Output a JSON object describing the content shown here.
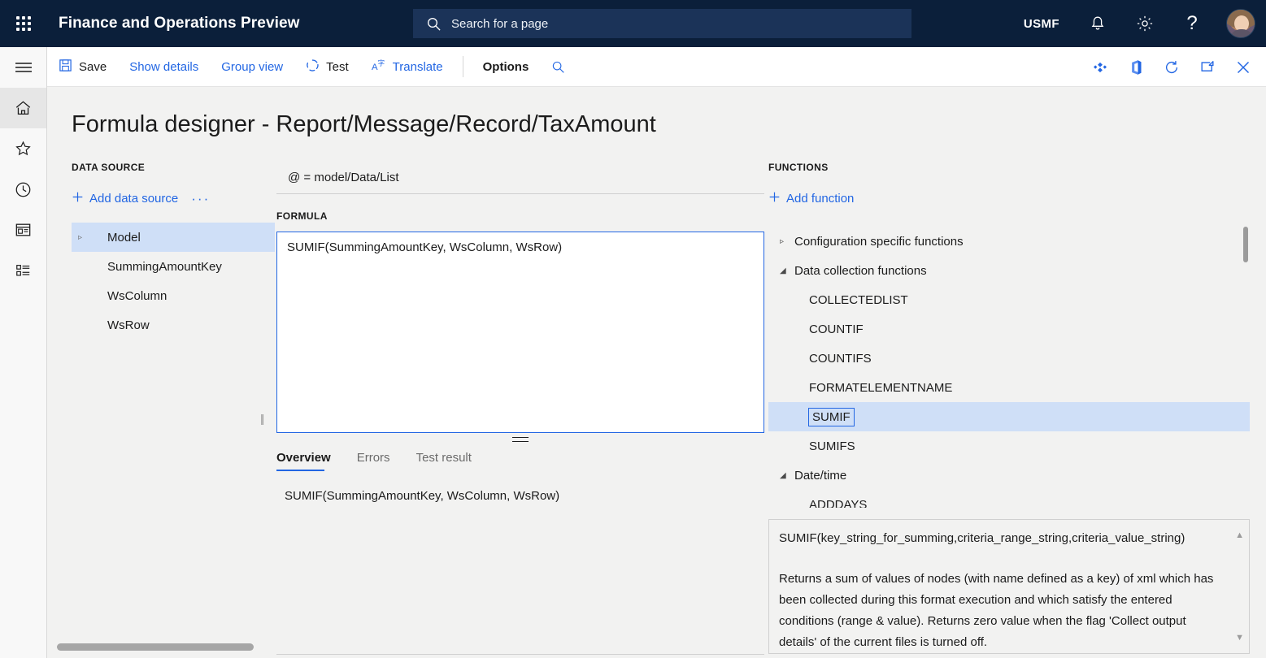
{
  "topbar": {
    "waffle_icon": "app-launcher-icon",
    "app_title": "Finance and Operations Preview",
    "search": {
      "icon": "search-icon",
      "placeholder": "Search for a page",
      "value": ""
    },
    "company": "USMF",
    "notifications_icon": "bell-icon",
    "settings_icon": "gear-icon",
    "help_icon": "question-mark-icon",
    "avatar_label": "user-avatar"
  },
  "rail": {
    "items": [
      {
        "name": "hamburger-menu",
        "icon": "hamburger-icon",
        "active": false
      },
      {
        "name": "home",
        "icon": "home-icon",
        "active": true
      },
      {
        "name": "favorites",
        "icon": "star-icon",
        "active": false
      },
      {
        "name": "recent",
        "icon": "clock-icon",
        "active": false
      },
      {
        "name": "workspaces",
        "icon": "workspace-icon",
        "active": false
      },
      {
        "name": "modules",
        "icon": "list-icon",
        "active": false
      }
    ]
  },
  "commandbar": {
    "save": {
      "label": "Save",
      "icon": "save-icon"
    },
    "show_details": {
      "label": "Show details"
    },
    "group_view": {
      "label": "Group view"
    },
    "test": {
      "label": "Test",
      "icon": "test-spinner-icon"
    },
    "translate": {
      "label": "Translate",
      "icon": "translate-icon"
    },
    "options": {
      "label": "Options"
    },
    "search": {
      "icon": "search-icon"
    },
    "right_icons": [
      {
        "name": "personalize-icon"
      },
      {
        "name": "office-app-icon"
      },
      {
        "name": "refresh-icon"
      },
      {
        "name": "open-in-new-window-icon"
      },
      {
        "name": "close-icon"
      }
    ]
  },
  "page": {
    "title": "Formula designer - Report/Message/Record/TaxAmount",
    "data_source": {
      "label": "DATA SOURCE",
      "add_button": "Add data source",
      "overflow_button": "···",
      "tree": [
        {
          "label": "Model",
          "expander": "▹",
          "selected": true,
          "leaf": false
        },
        {
          "label": "SummingAmountKey",
          "expander": "",
          "selected": false,
          "leaf": true
        },
        {
          "label": "WsColumn",
          "expander": "",
          "selected": false,
          "leaf": true
        },
        {
          "label": "WsRow",
          "expander": "",
          "selected": false,
          "leaf": true
        }
      ]
    },
    "center": {
      "binding": "@  =  model/Data/List",
      "formula_label": "FORMULA",
      "formula_value": "SUMIF(SummingAmountKey, WsColumn, WsRow)",
      "tabs": [
        {
          "label": "Overview",
          "active": true
        },
        {
          "label": "Errors",
          "active": false
        },
        {
          "label": "Test result",
          "active": false
        }
      ],
      "overview_text": "SUMIF(SummingAmountKey, WsColumn, WsRow)"
    },
    "functions": {
      "label": "FUNCTIONS",
      "add_button": "Add function",
      "tree": [
        {
          "label": "Configuration specific functions",
          "expander": "▹",
          "kind": "group",
          "selected": false
        },
        {
          "label": "Data collection functions",
          "expander": "◢",
          "kind": "group",
          "selected": false
        },
        {
          "label": "COLLECTEDLIST",
          "expander": "",
          "kind": "leaf",
          "selected": false
        },
        {
          "label": "COUNTIF",
          "expander": "",
          "kind": "leaf",
          "selected": false
        },
        {
          "label": "COUNTIFS",
          "expander": "",
          "kind": "leaf",
          "selected": false
        },
        {
          "label": "FORMATELEMENTNAME",
          "expander": "",
          "kind": "leaf",
          "selected": false
        },
        {
          "label": "SUMIF",
          "expander": "",
          "kind": "leaf",
          "selected": true
        },
        {
          "label": "SUMIFS",
          "expander": "",
          "kind": "leaf",
          "selected": false
        },
        {
          "label": "Date/time",
          "expander": "◢",
          "kind": "group",
          "selected": false
        },
        {
          "label": "ADDDAYS",
          "expander": "",
          "kind": "leaf",
          "selected": false
        }
      ],
      "description_signature": "SUMIF(key_string_for_summing,criteria_range_string,criteria_value_string)",
      "description_text": "Returns a sum of values of nodes (with name defined as a key) of xml which has been collected during this format execution and which satisfy the entered conditions (range & value). Returns zero value when the flag 'Collect output details' of the current files is turned off.",
      "scroll_up_icon": "▲",
      "scroll_down_icon": "▼"
    }
  },
  "colors": {
    "brand_navy": "#0b1f3a",
    "accent_blue": "#2266e3",
    "selection_blue": "#cfdff7",
    "page_bg": "#f2f2f1"
  }
}
